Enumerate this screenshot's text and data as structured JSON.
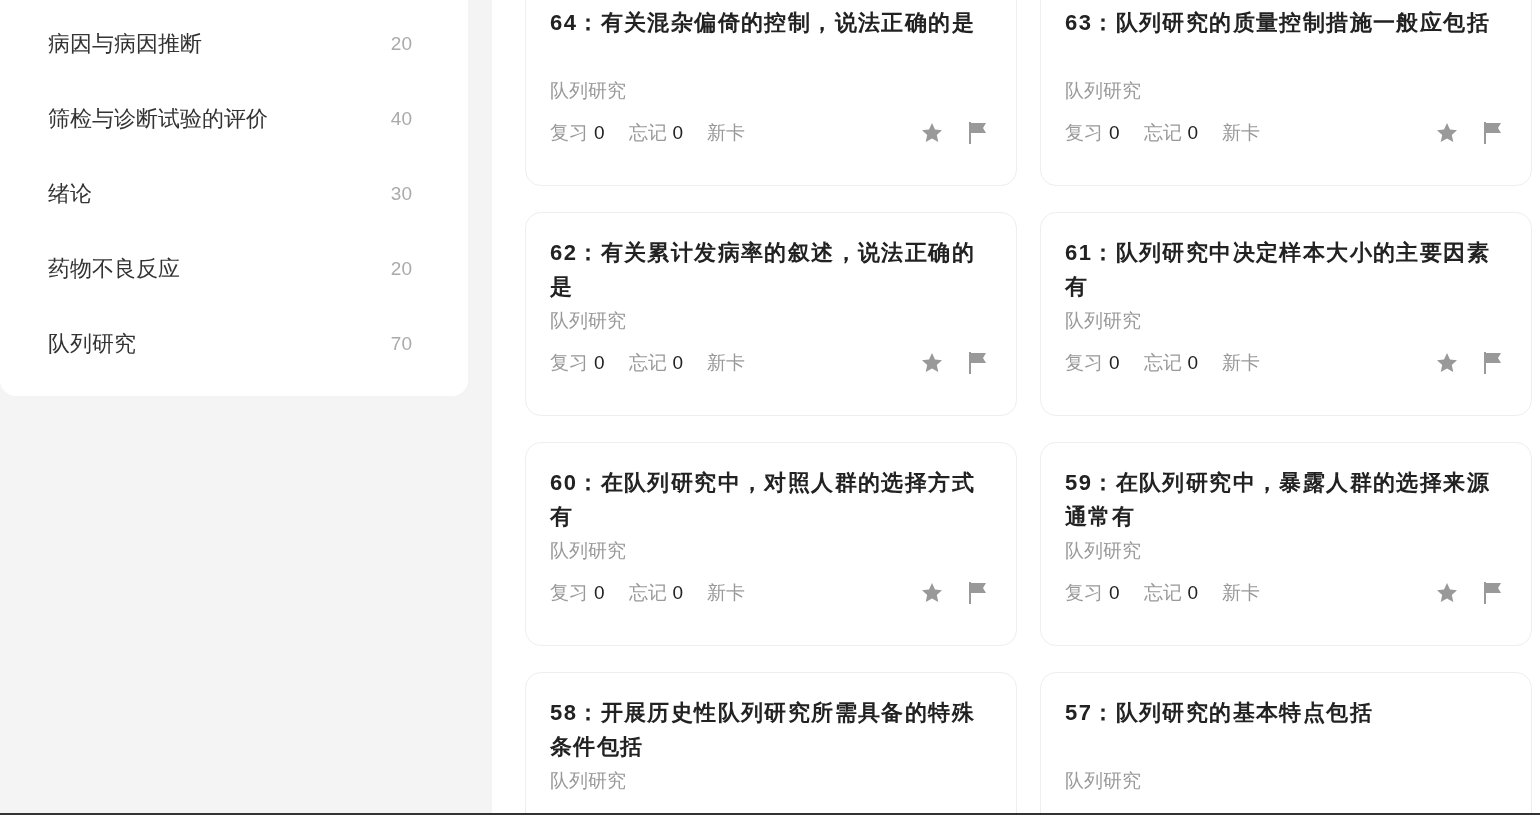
{
  "sidebar": {
    "items": [
      {
        "label": "病因与病因推断",
        "count": "20"
      },
      {
        "label": "筛检与诊断试验的评价",
        "count": "40"
      },
      {
        "label": "绪论",
        "count": "30"
      },
      {
        "label": "药物不良反应",
        "count": "20"
      },
      {
        "label": "队列研究",
        "count": "70"
      }
    ]
  },
  "cards": [
    {
      "title": "64：有关混杂偏倚的控制，说法正确的是",
      "category": "队列研究",
      "review_label": "复习",
      "review_count": "0",
      "forget_label": "忘记",
      "forget_count": "0",
      "status": "新卡"
    },
    {
      "title": "63：队列研究的质量控制措施一般应包括",
      "category": "队列研究",
      "review_label": "复习",
      "review_count": "0",
      "forget_label": "忘记",
      "forget_count": "0",
      "status": "新卡"
    },
    {
      "title": "62：有关累计发病率的叙述，说法正确的是",
      "category": "队列研究",
      "review_label": "复习",
      "review_count": "0",
      "forget_label": "忘记",
      "forget_count": "0",
      "status": "新卡"
    },
    {
      "title": "61：队列研究中决定样本大小的主要因素有",
      "category": "队列研究",
      "review_label": "复习",
      "review_count": "0",
      "forget_label": "忘记",
      "forget_count": "0",
      "status": "新卡"
    },
    {
      "title": "60：在队列研究中，对照人群的选择方式有",
      "category": "队列研究",
      "review_label": "复习",
      "review_count": "0",
      "forget_label": "忘记",
      "forget_count": "0",
      "status": "新卡"
    },
    {
      "title": "59：在队列研究中，暴露人群的选择来源通常有",
      "category": "队列研究",
      "review_label": "复习",
      "review_count": "0",
      "forget_label": "忘记",
      "forget_count": "0",
      "status": "新卡"
    },
    {
      "title": "58：开展历史性队列研究所需具备的特殊条件包括",
      "category": "队列研究"
    },
    {
      "title": "57：队列研究的基本特点包括",
      "category": "队列研究"
    }
  ]
}
